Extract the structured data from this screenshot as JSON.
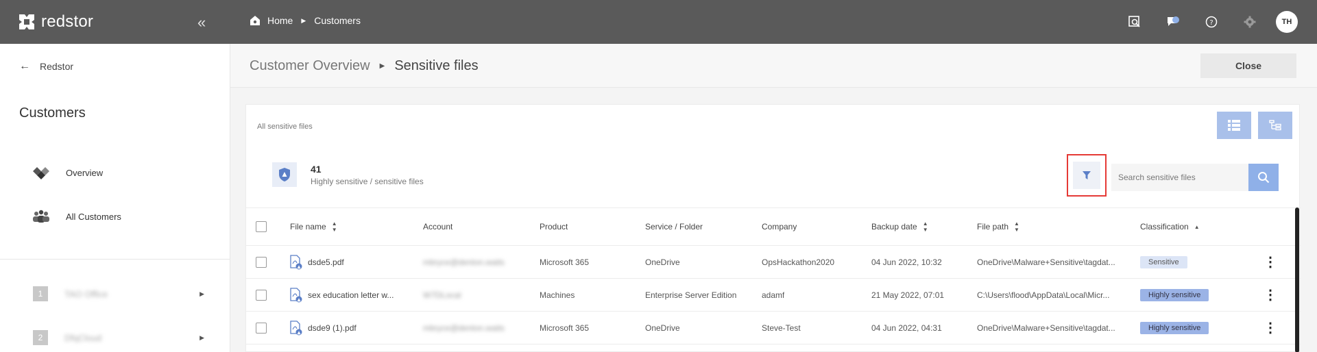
{
  "topbar": {
    "brand": "redstor",
    "breadcrumb": [
      "Home",
      "Customers"
    ],
    "avatar": "TH",
    "icons": [
      "search-window-icon",
      "chat-icon",
      "help-icon",
      "settings-icon"
    ]
  },
  "sidebar": {
    "back_label": "Redstor",
    "title": "Customers",
    "nav": [
      {
        "label": "Overview",
        "icon": "overview-icon"
      },
      {
        "label": "All Customers",
        "icon": "people-icon"
      }
    ],
    "customers": [
      {
        "num": "1",
        "name": "TAO Office"
      },
      {
        "num": "2",
        "name": "DfqCloud"
      }
    ]
  },
  "page": {
    "title_parent": "Customer Overview",
    "title_current": "Sensitive files",
    "close_label": "Close"
  },
  "card": {
    "label": "All sensitive files",
    "count": "41",
    "count_desc": "Highly sensitive / sensitive files",
    "search_placeholder": "Search sensitive files"
  },
  "table": {
    "headers": [
      "File name",
      "Account",
      "Product",
      "Service / Folder",
      "Company",
      "Backup date",
      "File path",
      "Classification"
    ],
    "rows": [
      {
        "file": "dsde5.pdf",
        "account": "mbryce@denton.waits",
        "product": "Microsoft 365",
        "service": "OneDrive",
        "company": "OpsHackathon2020",
        "date": "04 Jun 2022, 10:32",
        "path": "OneDrive\\Malware+Sensitive\\tagdat...",
        "class": "Sensitive",
        "class_type": "sensitive"
      },
      {
        "file": "sex education letter w...",
        "account": "W7DLocal",
        "product": "Machines",
        "service": "Enterprise Server Edition",
        "company": "adamf",
        "date": "21 May 2022, 07:01",
        "path": "C:\\Users\\flood\\AppData\\Local\\Micr...",
        "class": "Highly sensitive",
        "class_type": "high"
      },
      {
        "file": "dsde9 (1).pdf",
        "account": "mbryce@denton.waits",
        "product": "Microsoft 365",
        "service": "OneDrive",
        "company": "Steve-Test",
        "date": "04 Jun 2022, 04:31",
        "path": "OneDrive\\Malware+Sensitive\\tagdat...",
        "class": "Highly sensitive",
        "class_type": "high"
      }
    ]
  },
  "colors": {
    "topbar": "#5a5a5a",
    "accent": "#8fb0e8",
    "highlight": "#e53935"
  }
}
